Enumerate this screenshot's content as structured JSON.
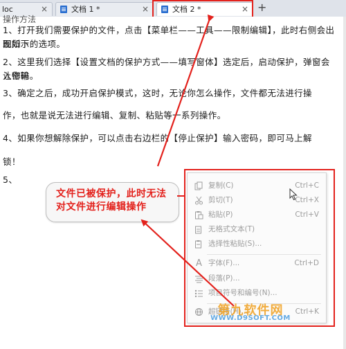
{
  "tabs": [
    {
      "label": "loc",
      "active": false
    },
    {
      "label": "文档 1 *",
      "active": false
    },
    {
      "label": "文档 2 *",
      "active": true
    }
  ],
  "tab_close_glyph": "×",
  "add_tab_glyph": "+",
  "document": {
    "top_fragment": "操作方法",
    "paragraphs": [
      "1、打开我们需要保护的文件，点击【菜单栏——工具——限制编辑】，此时右侧会出现如下",
      "图所示的选项。",
      "2、这里我们选择【设置文档的保护方式——填写窗体】选定后，启动保护，弹窗会让你输",
      "入密码。",
      "3、确定之后，成功开启保护模式，这时，无论你怎么操作，文件都无法进行操",
      "作，也就是说无法进行编辑、复制、粘贴等一系列操作。",
      "4、如果你想解除保护，可以点击右边栏的【停止保护】输入密码，即可马上解",
      "锁！",
      "5、"
    ]
  },
  "callout": {
    "line1": "文件已被保护，此时无法",
    "line2": "对文件进行编辑操作"
  },
  "context_menu": {
    "items": [
      {
        "icon": "copy-icon",
        "label": "复制(C)",
        "shortcut": "Ctrl+C"
      },
      {
        "icon": "cut-icon",
        "label": "剪切(T)",
        "shortcut": "Ctrl+X"
      },
      {
        "icon": "paste-icon",
        "label": "粘贴(P)",
        "shortcut": "Ctrl+V"
      },
      {
        "icon": "plain-text-icon",
        "label": "无格式文本(T)",
        "shortcut": ""
      },
      {
        "icon": "paste-special-icon",
        "label": "选择性粘贴(S)...",
        "shortcut": ""
      },
      {
        "icon": "font-icon",
        "label": "字体(F)...",
        "shortcut": "Ctrl+D"
      },
      {
        "icon": "paragraph-icon",
        "label": "段落(P)...",
        "shortcut": ""
      },
      {
        "icon": "list-icon",
        "label": "项目符号和编号(N)...",
        "shortcut": ""
      },
      {
        "icon": "hyperlink-icon",
        "label": "超链接(H)...",
        "shortcut": "Ctrl+K"
      }
    ]
  },
  "watermark": {
    "line1": "第九软件网",
    "line2": "WWW.D9SOFT.COM"
  },
  "colors": {
    "annotation_red": "#e3211c",
    "menu_disabled_text": "#9c9c9c",
    "tab_icon_blue": "#2b6fd0"
  }
}
